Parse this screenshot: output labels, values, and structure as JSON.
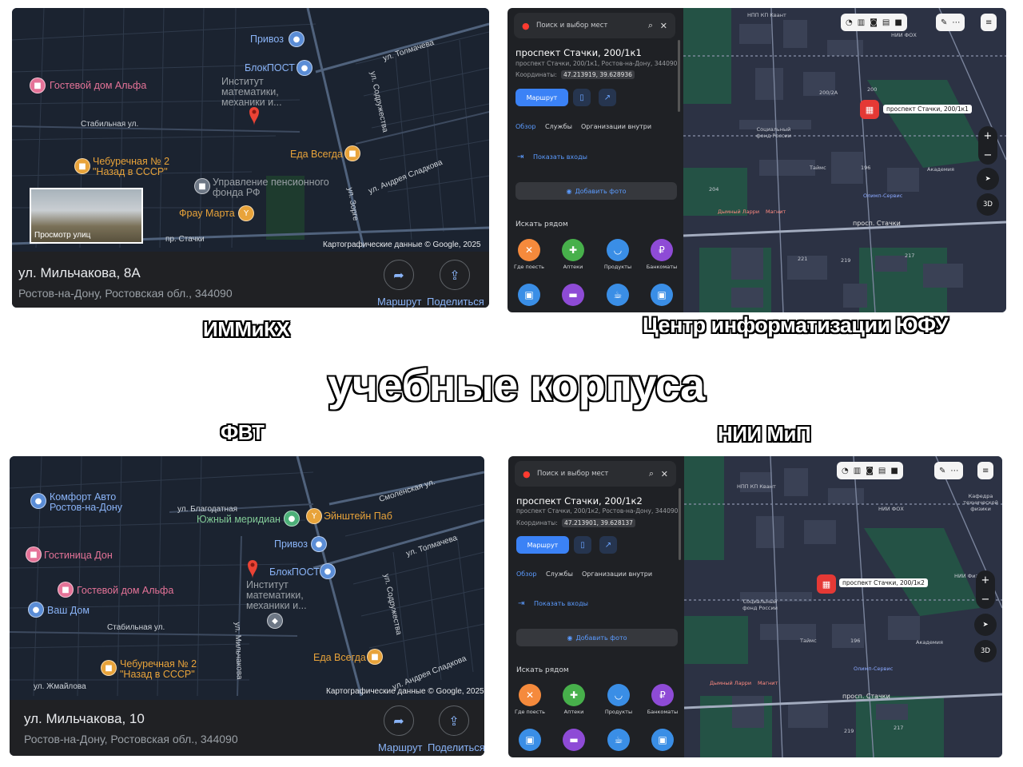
{
  "captions": {
    "main": "учебные корпуса",
    "top_left": "ИММиКХ",
    "top_right": "Центр информатизации ЮФУ",
    "bottom_left": "ФВТ",
    "bottom_right": "НИИ МиП"
  },
  "gmap1": {
    "title": "ул. Мильчакова, 8А",
    "subtitle": "Ростов-на-Дону, Ростовская обл., 344090",
    "route_label": "Маршрут",
    "share_label": "Поделиться",
    "copyright": "Картографические данные © Google, 2025",
    "streetview_label": "Просмотр улиц",
    "pois": {
      "privoz": "Привоз",
      "blokpost": "БлокПОСТ",
      "institute": "Институт математики, механики и...",
      "guesthouse": "Гостевой дом Альфа",
      "cheburechnaya": "Чебуречная № 2 \"Назад в СССР\"",
      "eda": "Еда Всегда",
      "pension": "Управление пенсионного фонда РФ",
      "frau": "Фрау Марта"
    },
    "streets": {
      "tolmacheva": "ул. Толмачева",
      "sodruzhestva": "ул. Содружества",
      "stabilnaya": "Стабильная ул.",
      "sladkova": "ул. Андрея Сладкова",
      "zorge": "ул. Зорге",
      "stachki": "пр. Стачки"
    },
    "accent": "#8ab4f8"
  },
  "gmap2": {
    "title": "ул. Мильчакова, 10",
    "subtitle": "Ростов-на-Дону, Ростовская обл., 344090",
    "route_label": "Маршрут",
    "share_label": "Поделиться",
    "copyright": "Картографические данные © Google, 2025",
    "pois": {
      "comfort": "Комфорт Авто Ростов-на-Дону",
      "meridian": "Южный меридиан",
      "einstein": "Эйнштейн Паб",
      "privoz": "Привоз",
      "hotel_don": "Гостиница Дон",
      "blokpost": "БлокПОСТ",
      "institute": "Институт математики, механики и...",
      "guesthouse": "Гостевой дом Альфа",
      "vash_dom": "Ваш Дом",
      "cheburechnaya": "Чебуречная № 2 \"Назад в СССР\"",
      "eda": "Еда Всегда"
    },
    "streets": {
      "smolenskaya": "Смоленская ул.",
      "blagodatnaya": "ул. Благодатная",
      "tolmacheva": "ул. Толмачева",
      "sodruzhestva": "ул. Содружества",
      "stabilnaya": "Стабильная ул.",
      "milchakova": "ул. Мильчакова",
      "sladkova": "ул. Андрея Сладкова",
      "zhmaylova": "ул. Жмайлова"
    }
  },
  "ymap1": {
    "search_placeholder": "Поиск и выбор мест",
    "title": "проспект Стачки, 200/1к1",
    "address": "проспект Стачки, 200/1к1, Ростов-на-Дону, 344090",
    "coords_label": "Координаты:",
    "coords": "47.213919, 39.628936",
    "route_label": "Маршрут",
    "tabs": [
      "Обзор",
      "Службы",
      "Организации внутри"
    ],
    "entrances": "Показать входы",
    "add_photo": "Добавить фото",
    "nearby": "Искать рядом",
    "cats": [
      "Где поесть",
      "Аптеки",
      "Продукты",
      "Банкоматы"
    ],
    "pin_label": "проспект Стачки, 200/1к1",
    "map_labels": {
      "npp": "НПП КП Квант",
      "nii_fox": "НИИ ФОХ",
      "sfr": "Социальный фонд России",
      "taims": "Таймс",
      "academy": "Академия",
      "olimp": "Олимп-Сервис",
      "larri": "Дымный Ларри",
      "magnit": "Магнит",
      "stachki": "просп. Стачки",
      "b200": "200",
      "b200a": "200/2А",
      "b196": "196",
      "b204": "204",
      "b221": "221",
      "b219": "219",
      "b217": "217",
      "b3d": "3D"
    }
  },
  "ymap2": {
    "search_placeholder": "Поиск и выбор мест",
    "title": "проспект Стачки, 200/1к2",
    "address": "проспект Стачки, 200/1к2, Ростов-на-Дону, 344090",
    "coords_label": "Координаты:",
    "coords": "47.213901, 39.628137",
    "route_label": "Маршрут",
    "tabs": [
      "Обзор",
      "Службы",
      "Организации внутри"
    ],
    "entrances": "Показать входы",
    "add_photo": "Добавить фото",
    "nearby": "Искать рядом",
    "cats": [
      "Где поесть",
      "Аптеки",
      "Продукты",
      "Банкоматы"
    ],
    "pin_label": "проспект Стачки, 200/1к2",
    "map_labels": {
      "npp": "НПП КП Квант",
      "nii_fox": "НИИ ФОХ",
      "kafedra": "Кафедра технической физики",
      "nii_fiz": "НИИ Физики",
      "sfr": "Социальный фонд России",
      "taims": "Таймс",
      "academy": "Академия",
      "olimp": "Олимп-Сервис",
      "larri": "Дымный Ларри",
      "magnit": "Магнит",
      "stachki": "просп. Стачки",
      "b196": "196",
      "b219": "219",
      "b217": "217",
      "b3d": "3D"
    }
  }
}
